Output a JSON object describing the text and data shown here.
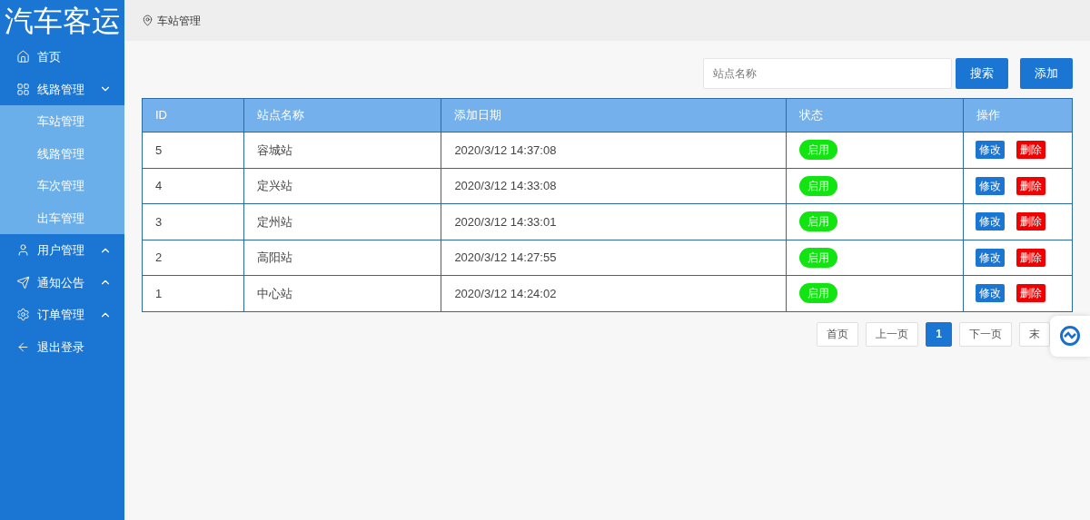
{
  "logo": "汽车客运",
  "sidebar": {
    "items": [
      {
        "label": "首页"
      },
      {
        "label": "线路管理",
        "expanded": true,
        "children": [
          {
            "label": "车站管理"
          },
          {
            "label": "线路管理"
          },
          {
            "label": "车次管理"
          },
          {
            "label": "出车管理"
          }
        ]
      },
      {
        "label": "用户管理",
        "expanded": false
      },
      {
        "label": "通知公告",
        "expanded": false
      },
      {
        "label": "订单管理",
        "expanded": false
      },
      {
        "label": "退出登录"
      }
    ]
  },
  "breadcrumb": "车站管理",
  "search": {
    "placeholder": "站点名称",
    "buttons": [
      "搜索",
      "添加"
    ]
  },
  "table": {
    "columns": [
      "ID",
      "站点名称",
      "添加日期",
      "状态",
      "操作"
    ],
    "rows": [
      {
        "id": "5",
        "name": "容城站",
        "date": "2020/3/12 14:37:08",
        "status": {
          "label": "启用",
          "enabled": true
        },
        "actions": [
          "修改",
          "删除"
        ]
      },
      {
        "id": "4",
        "name": "定兴站",
        "date": "2020/3/12 14:33:08",
        "status": {
          "label": "启用",
          "enabled": true
        },
        "actions": [
          "修改",
          "删除"
        ]
      },
      {
        "id": "3",
        "name": "定州站",
        "date": "2020/3/12 14:33:01",
        "status": {
          "label": "启用",
          "enabled": true
        },
        "actions": [
          "修改",
          "删除"
        ]
      },
      {
        "id": "2",
        "name": "高阳站",
        "date": "2020/3/12 14:27:55",
        "status": {
          "label": "启用",
          "enabled": true
        },
        "actions": [
          "修改",
          "删除"
        ]
      },
      {
        "id": "1",
        "name": "中心站",
        "date": "2020/3/12 14:24:02",
        "status": {
          "label": "启用",
          "enabled": true
        },
        "actions": [
          "修改",
          "删除"
        ]
      }
    ]
  },
  "pagination": [
    {
      "label": "首页",
      "selected": false
    },
    {
      "label": "上一页",
      "selected": false
    },
    {
      "label": "1",
      "selected": true
    },
    {
      "label": "下一页",
      "selected": false
    },
    {
      "label": "末",
      "selected": false
    }
  ]
}
